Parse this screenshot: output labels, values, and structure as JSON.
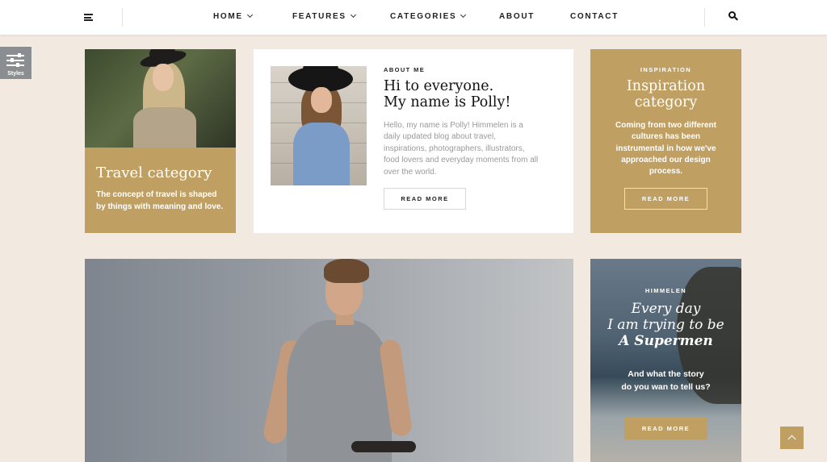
{
  "nav": {
    "items": [
      {
        "label": "HOME",
        "has_dropdown": true
      },
      {
        "label": "FEATURES",
        "has_dropdown": true
      },
      {
        "label": "CATEGORIES",
        "has_dropdown": true
      },
      {
        "label": "ABOUT",
        "has_dropdown": false
      },
      {
        "label": "CONTACT",
        "has_dropdown": false
      }
    ],
    "menu_icon": "hamburger-menu-icon",
    "search_icon": "search-icon"
  },
  "styles_panel": {
    "label": "Styles",
    "icon": "sliders-icon"
  },
  "travel_card": {
    "title": "Travel category",
    "text": "The concept of travel is shaped by things with meaning and love."
  },
  "about_card": {
    "eyebrow": "ABOUT ME",
    "heading_line1": "Hi to everyone.",
    "heading_line2": "My name is Polly!",
    "text": "Hello, my name is Polly! Himmelen is a daily updated blog about travel, inspirations, photographers, illustrators, food lovers and everyday moments from all over the world.",
    "button": "READ MORE"
  },
  "inspiration_card": {
    "eyebrow": "INSPIRATION",
    "title_line1": "Inspiration",
    "title_line2": "category",
    "text": "Coming from two different cultures has been instrumental in how we've approached our design process.",
    "button": "READ MORE"
  },
  "himmelen_card": {
    "eyebrow": "HIMMELEN",
    "headline_line1": "Every day",
    "headline_line2": "I am trying to be",
    "headline_line3": "A Supermen",
    "text_line1": "And what the story",
    "text_line2": "do you wan to tell us?",
    "button": "READ MORE"
  },
  "colors": {
    "background": "#f2e9e1",
    "accent_gold": "#c0a062",
    "topbar": "#ffffff",
    "styles_tab": "#8a8e91"
  }
}
